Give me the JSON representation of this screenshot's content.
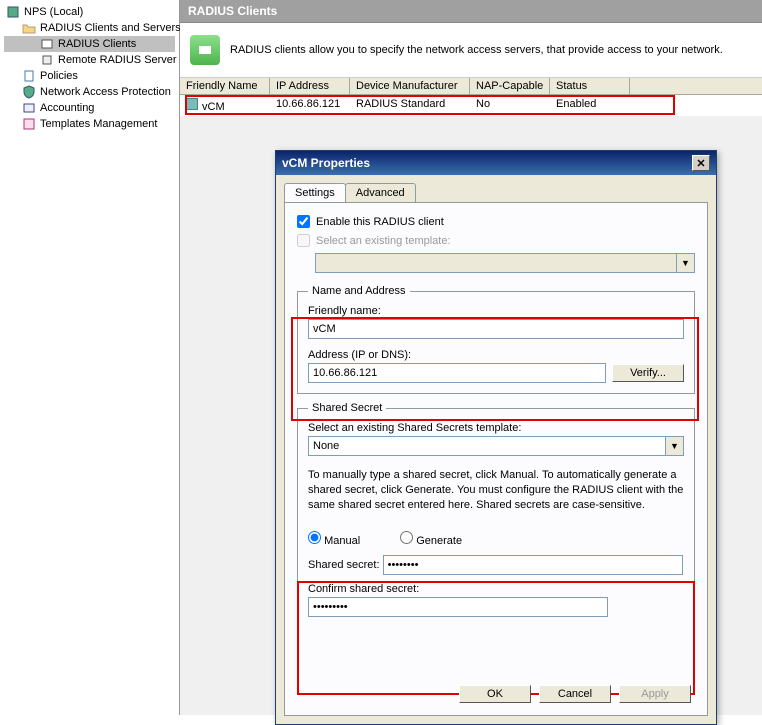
{
  "tree": {
    "root": "NPS (Local)",
    "items": [
      "RADIUS Clients and Servers",
      "RADIUS Clients",
      "Remote RADIUS Server G",
      "Policies",
      "Network Access Protection",
      "Accounting",
      "Templates Management"
    ]
  },
  "header": {
    "title": "RADIUS Clients"
  },
  "info": {
    "text": "RADIUS clients allow you to specify the network access servers, that provide access to your network."
  },
  "table": {
    "headers": [
      "Friendly Name",
      "IP Address",
      "Device Manufacturer",
      "NAP-Capable",
      "Status"
    ],
    "row": {
      "name": "vCM",
      "ip": "10.66.86.121",
      "mfr": "RADIUS Standard",
      "nap": "No",
      "status": "Enabled"
    }
  },
  "dialog": {
    "title": "vCM Properties",
    "tabs": [
      "Settings",
      "Advanced"
    ],
    "enable_label": "Enable this RADIUS client",
    "select_template_label": "Select an existing template:",
    "name_address": {
      "legend": "Name and Address",
      "friendly_label": "Friendly name:",
      "friendly_value": "vCM",
      "address_label": "Address (IP or DNS):",
      "address_value": "10.66.86.121",
      "verify_label": "Verify..."
    },
    "shared_secret": {
      "legend": "Shared Secret",
      "template_label": "Select an existing Shared Secrets template:",
      "template_value": "None",
      "help_text": "To manually type a shared secret, click Manual. To automatically generate a shared secret, click Generate. You must configure the RADIUS client with the same shared secret entered here. Shared secrets are case-sensitive.",
      "manual_label": "Manual",
      "generate_label": "Generate",
      "secret_label": "Shared secret:",
      "secret_value": "••••••••",
      "confirm_label": "Confirm shared secret:",
      "confirm_value": "•••••••••"
    },
    "buttons": {
      "ok": "OK",
      "cancel": "Cancel",
      "apply": "Apply"
    }
  }
}
